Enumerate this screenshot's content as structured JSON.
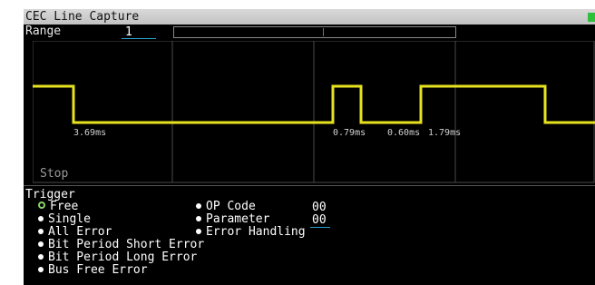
{
  "window": {
    "title": "CEC Line Capture"
  },
  "range": {
    "label": "Range",
    "value": "1"
  },
  "waveform": {
    "timings": [
      "3.69ms",
      "0.79ms",
      "0.60ms",
      "1.79ms"
    ],
    "status": "Stop"
  },
  "trigger": {
    "heading": "Trigger",
    "options": [
      {
        "label": "Free",
        "selected": true
      },
      {
        "label": "Single",
        "selected": false
      },
      {
        "label": "All Error",
        "selected": false
      },
      {
        "label": "Bit Period Short Error",
        "selected": false
      },
      {
        "label": "Bit Period Long Error",
        "selected": false
      },
      {
        "label": "Bus Free Error",
        "selected": false
      }
    ],
    "fields": [
      {
        "label": "OP Code",
        "value": "00"
      },
      {
        "label": "Parameter",
        "value": "00"
      },
      {
        "label": "Error Handling"
      }
    ]
  },
  "colors": {
    "signal": "#e6e21f",
    "grid": "#4a4a4a",
    "accent": "#28a0c8",
    "status_led": "#2fbf3a"
  }
}
